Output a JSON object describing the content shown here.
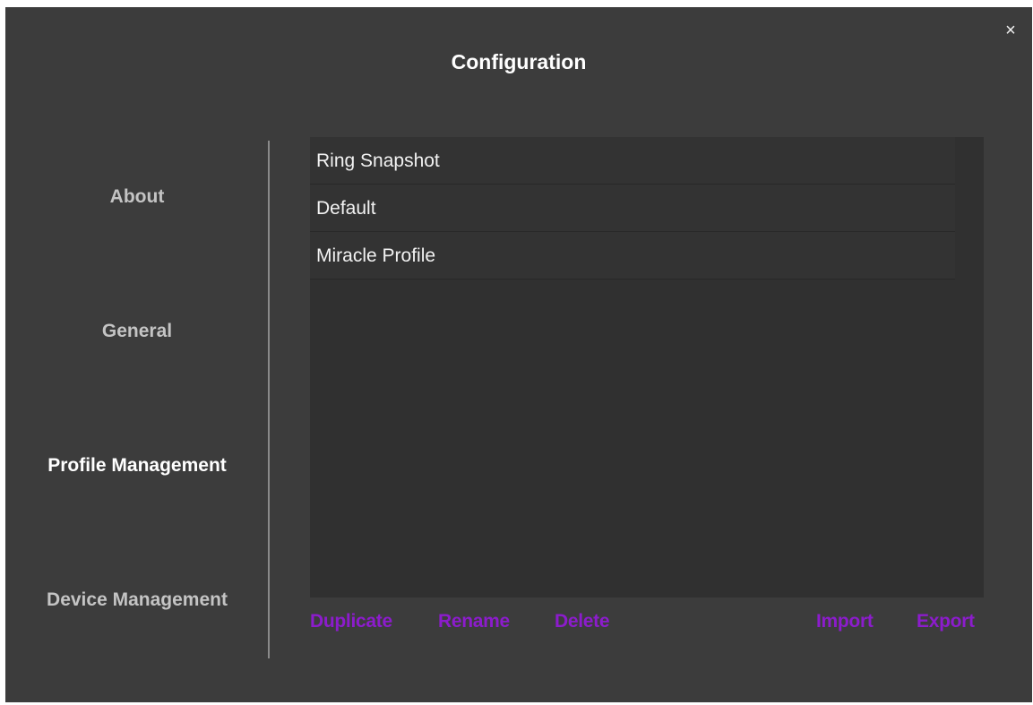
{
  "window": {
    "title": "Configuration",
    "close_symbol": "×"
  },
  "nav": {
    "items": [
      {
        "label": "About",
        "active": false
      },
      {
        "label": "General",
        "active": false
      },
      {
        "label": "Profile Management",
        "active": true
      },
      {
        "label": "Device Management",
        "active": false
      }
    ]
  },
  "profiles": {
    "items": [
      "Ring Snapshot",
      "Default",
      "Miracle Profile"
    ]
  },
  "actions": {
    "duplicate": "Duplicate",
    "rename": "Rename",
    "delete": "Delete",
    "import": "Import",
    "export": "Export"
  },
  "colors": {
    "background": "#3c3c3c",
    "panel": "#303030",
    "accent": "#8c1ccc",
    "text_active": "#ffffff",
    "text_inactive": "#c4c4c4"
  }
}
